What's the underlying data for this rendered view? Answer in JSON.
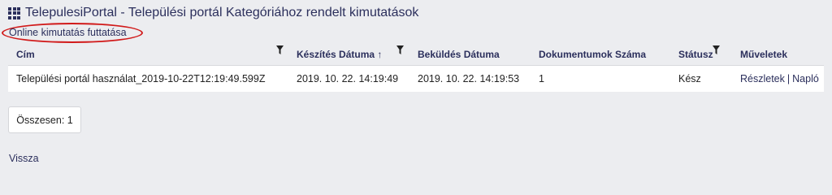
{
  "header": {
    "title": "TelepulesiPortal - Települési portál Kategóriához rendelt kimutatások",
    "icon": "grid-icon"
  },
  "actions": {
    "online_run_label": "Online kimutatás futtatása"
  },
  "table": {
    "columns": [
      {
        "label": "Cím",
        "filter": true
      },
      {
        "label": "Készítés Dátuma ↑",
        "filter": true
      },
      {
        "label": "Beküldés Dátuma",
        "filter": false
      },
      {
        "label": "Dokumentumok Száma",
        "filter": false
      },
      {
        "label": "Státusz",
        "filter": true
      },
      {
        "label": "Műveletek",
        "filter": false
      }
    ],
    "rows": [
      {
        "cim": "Települési portál használat_2019-10-22T12:19:49.599Z",
        "keszites": "2019. 10. 22. 14:19:49",
        "bekuldes": "2019. 10. 22. 14:19:53",
        "dokumentumok": "1",
        "statusz": "Kész",
        "reszletek": "Részletek",
        "separator": "|",
        "naplo": "Napló"
      }
    ]
  },
  "footer": {
    "total_label": "Összesen: 1",
    "back_label": "Vissza"
  },
  "colors": {
    "accent": "#2b2f5c",
    "highlight": "#d11a1a",
    "background": "#ecedf0"
  }
}
